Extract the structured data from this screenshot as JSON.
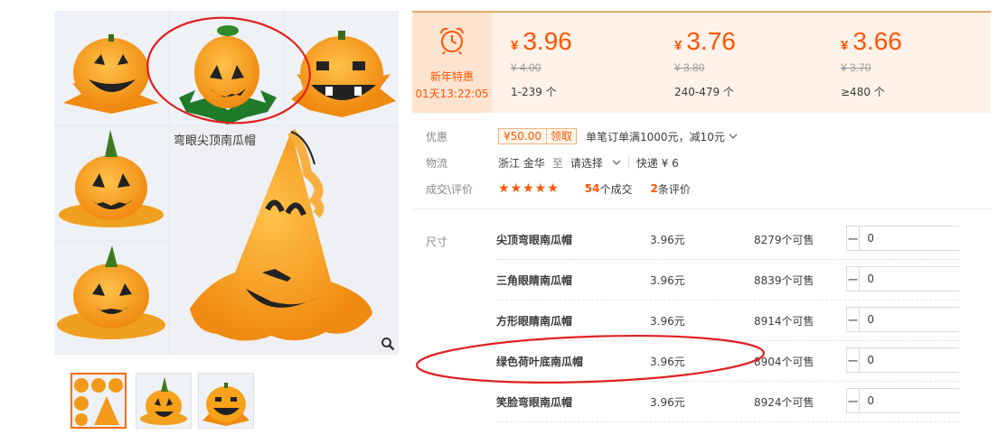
{
  "gallery": {
    "main_caption": "弯眼尖顶南瓜帽"
  },
  "promo": {
    "title": "新年特惠",
    "timer": "01天13:22:05"
  },
  "tiers": [
    {
      "currency": "¥",
      "price": "3.96",
      "old": "¥ 4.00",
      "range": "1-239 个"
    },
    {
      "currency": "¥",
      "price": "3.76",
      "old": "¥ 3.80",
      "range": "240-479 个"
    },
    {
      "currency": "¥",
      "price": "3.66",
      "old": "¥ 3.70",
      "range": "≥480 个"
    }
  ],
  "info": {
    "discount_label": "优惠",
    "coupon_amount": "¥50.00",
    "coupon_get": "领取",
    "coupon_rule": "单笔订单满1000元，减10元",
    "logistics_label": "物流",
    "origin": "浙江 金华",
    "to": "至",
    "destination": "请选择",
    "express": "快递 ¥ 6",
    "deals_label": "成交\\评价",
    "stars": "★★★★★",
    "deal_count": "54",
    "deal_text": "个成交",
    "review_count": "2",
    "review_text": "条评价"
  },
  "sku": {
    "label": "尺寸",
    "rows": [
      {
        "name": "尖顶弯眼南瓜帽",
        "price": "3.96元",
        "stock": "8279个可售",
        "qty": "0"
      },
      {
        "name": "三角眼睛南瓜帽",
        "price": "3.96元",
        "stock": "8839个可售",
        "qty": "0"
      },
      {
        "name": "方形眼睛南瓜帽",
        "price": "3.96元",
        "stock": "8914个可售",
        "qty": "0"
      },
      {
        "name": "绿色荷叶底南瓜帽",
        "price": "3.96元",
        "stock": "8904个可售",
        "qty": "0"
      },
      {
        "name": "笑脸弯眼南瓜帽",
        "price": "3.96元",
        "stock": "8924个可售",
        "qty": "0"
      }
    ]
  },
  "colors": {
    "accent": "#ff5500",
    "banner_bg": "#fff2e8",
    "annotation": "#e02020",
    "pumpkin": "#f7a21a"
  }
}
